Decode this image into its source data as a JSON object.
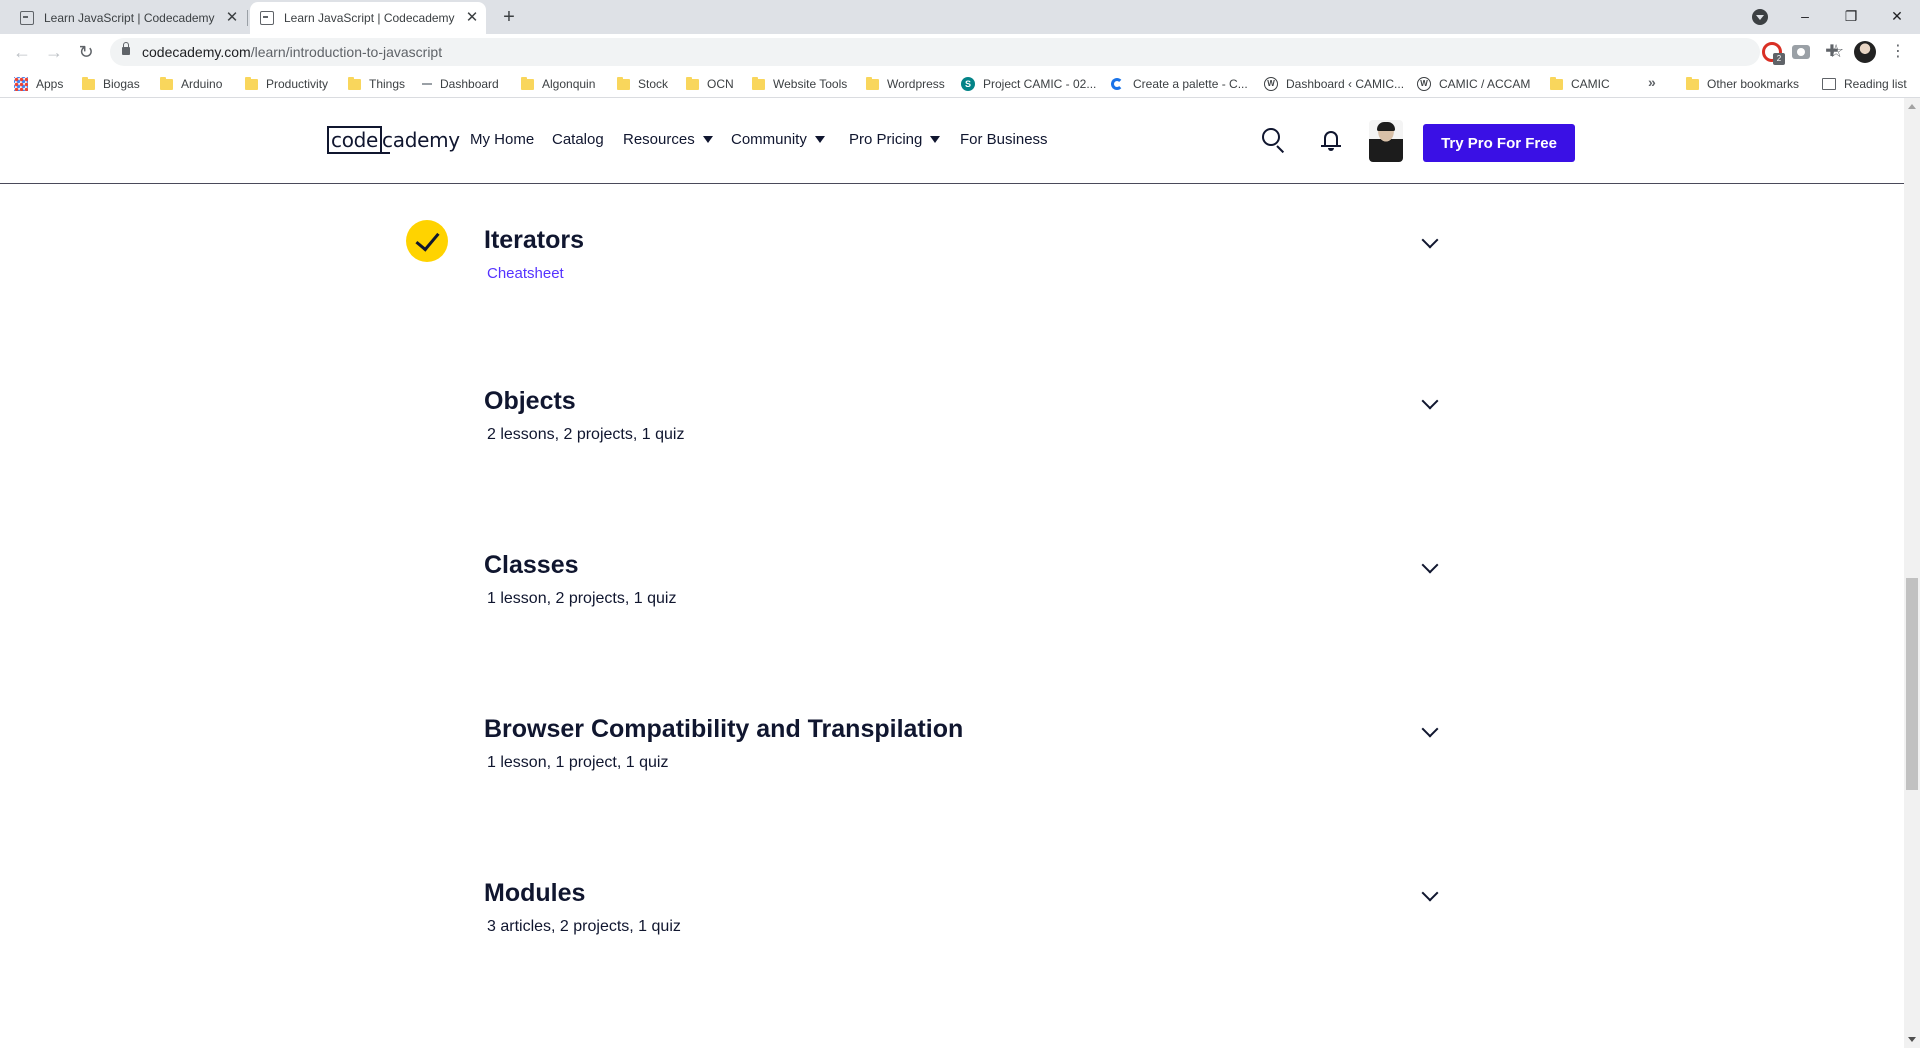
{
  "browser": {
    "tabs": [
      {
        "title": "Learn JavaScript | Codecademy",
        "active": false
      },
      {
        "title": "Learn JavaScript | Codecademy",
        "active": true
      }
    ],
    "new_tab_label": "+",
    "address": {
      "domain": "codecademy.com",
      "path": "/learn/introduction-to-javascript"
    },
    "extension_badge": "2",
    "bookmarks": [
      {
        "label": "Apps",
        "icon": "apps-grid-icon"
      },
      {
        "label": "Biogas",
        "icon": "folder-icon"
      },
      {
        "label": "Arduino",
        "icon": "folder-icon"
      },
      {
        "label": "Productivity",
        "icon": "folder-icon"
      },
      {
        "label": "Things",
        "icon": "folder-icon"
      },
      {
        "label": "Dashboard",
        "icon": "dash-icon"
      },
      {
        "label": "Algonquin",
        "icon": "folder-icon"
      },
      {
        "label": "Stock",
        "icon": "folder-icon"
      },
      {
        "label": "OCN",
        "icon": "folder-icon"
      },
      {
        "label": "Website Tools",
        "icon": "folder-icon"
      },
      {
        "label": "Wordpress",
        "icon": "folder-icon"
      },
      {
        "label": "Project CAMIC - 02...",
        "icon": "sharepoint-icon"
      },
      {
        "label": "Create a palette - C...",
        "icon": "coolors-icon"
      },
      {
        "label": "Dashboard ‹ CAMIC...",
        "icon": "wordpress-icon"
      },
      {
        "label": "CAMIC / ACCAM",
        "icon": "wordpress-icon"
      },
      {
        "label": "CAMIC",
        "icon": "folder-icon"
      }
    ],
    "bookmarks_overflow": "»",
    "other_bookmarks": "Other bookmarks",
    "reading_list": "Reading list"
  },
  "site": {
    "logo": {
      "boxed": "code",
      "rest": "cademy"
    },
    "nav": [
      {
        "label": "My Home",
        "dropdown": false
      },
      {
        "label": "Catalog",
        "dropdown": false
      },
      {
        "label": "Resources",
        "dropdown": true
      },
      {
        "label": "Community",
        "dropdown": true
      },
      {
        "label": "Pro Pricing",
        "dropdown": true
      },
      {
        "label": "For Business",
        "dropdown": false
      }
    ],
    "cta_label": "Try Pro For Free",
    "accent_color": "#3a10e5",
    "completed_color": "#ffd300"
  },
  "modules": [
    {
      "title": "Iterators",
      "subtitle": "Cheatsheet",
      "completed": true,
      "subtitle_is_link": true
    },
    {
      "title": "Objects",
      "subtitle": "2 lessons, 2 projects, 1 quiz",
      "completed": false,
      "subtitle_is_link": false
    },
    {
      "title": "Classes",
      "subtitle": "1 lesson, 2 projects, 1 quiz",
      "completed": false,
      "subtitle_is_link": false
    },
    {
      "title": "Browser Compatibility and Transpilation",
      "subtitle": "1 lesson, 1 project, 1 quiz",
      "completed": false,
      "subtitle_is_link": false
    },
    {
      "title": "Modules",
      "subtitle": "3 articles, 2 projects, 1 quiz",
      "completed": false,
      "subtitle_is_link": false
    }
  ]
}
